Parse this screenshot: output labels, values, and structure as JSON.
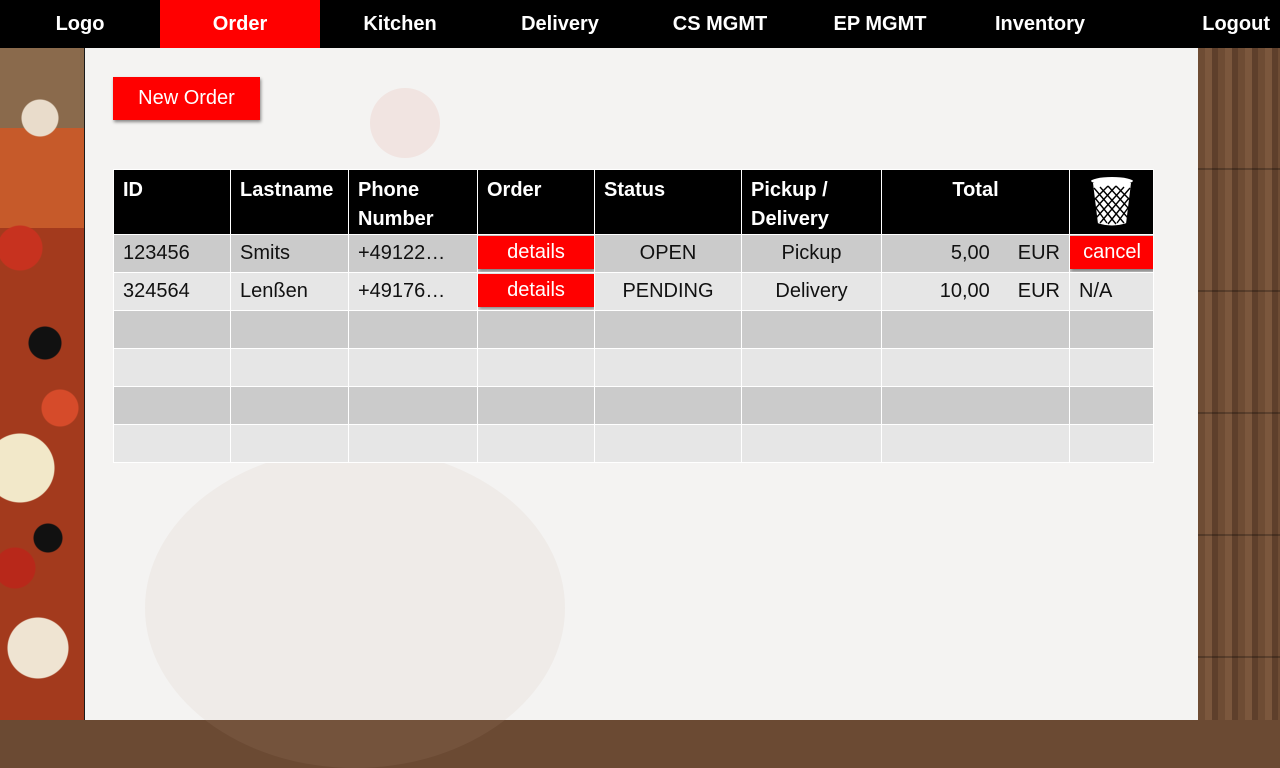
{
  "nav": {
    "items": [
      {
        "label": "Logo"
      },
      {
        "label": "Order"
      },
      {
        "label": "Kitchen"
      },
      {
        "label": "Delivery"
      },
      {
        "label": "CS MGMT"
      },
      {
        "label": "EP MGMT"
      },
      {
        "label": "Inventory"
      },
      {
        "label": "Logout"
      }
    ],
    "active": "Order"
  },
  "actions": {
    "new_order_label": "New Order"
  },
  "table": {
    "headers": {
      "id": "ID",
      "lastname": "Lastname",
      "phone_line1": "Phone",
      "phone_line2": "Number",
      "order": "Order",
      "status": "Status",
      "pickup_line1": "Pickup /",
      "pickup_line2": "Delivery",
      "total": "Total",
      "delete_icon": "trash-can-icon"
    },
    "rows": [
      {
        "id": "123456",
        "lastname": "Smits",
        "phone": "+49122…",
        "order_action": "details",
        "status": "OPEN",
        "mode": "Pickup",
        "total": "5,00",
        "currency": "EUR",
        "cancel": "cancel"
      },
      {
        "id": "324564",
        "lastname": "Lenßen",
        "phone": "+49176…",
        "order_action": "details",
        "status": "PENDING",
        "mode": "Delivery",
        "total": "10,00",
        "currency": "EUR",
        "cancel": "N/A"
      }
    ]
  },
  "colors": {
    "accent": "#ff0000",
    "header_bg": "#000000",
    "row_odd": "#cbcbcb",
    "row_even": "#e6e6e6"
  }
}
